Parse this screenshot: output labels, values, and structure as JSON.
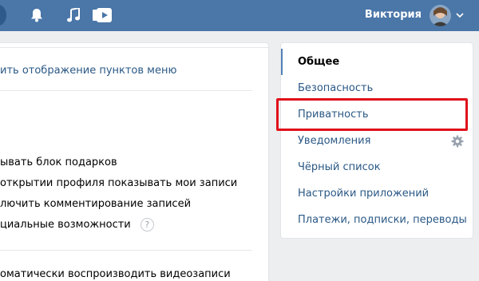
{
  "header": {
    "user_name": "Виктория",
    "icons": [
      "bell-icon",
      "music-icon",
      "video-icon",
      "chevron-down-icon"
    ],
    "bar_color": "#4a76a8"
  },
  "main": {
    "menu_link": "ить отображение пунктов меню",
    "options": [
      "ывать блок подарков",
      "открытии профиля показывать мои записи",
      "лючить комментирование записей",
      "циальные возможности"
    ],
    "help_icon_label": "?",
    "video_option": "оматически воспроизводить видеозаписи"
  },
  "nav": {
    "items": [
      {
        "label": "Общее",
        "active": true
      },
      {
        "label": "Безопасность",
        "active": false
      },
      {
        "label": "Приватность",
        "active": false
      },
      {
        "label": "Уведомления",
        "active": false
      },
      {
        "label": "Чёрный список",
        "active": false
      },
      {
        "label": "Настройки приложений",
        "active": false
      },
      {
        "label": "Платежи, подписки, переводы",
        "active": false
      }
    ],
    "highlight_color": "#e0101a",
    "link_color": "#2a5885"
  }
}
